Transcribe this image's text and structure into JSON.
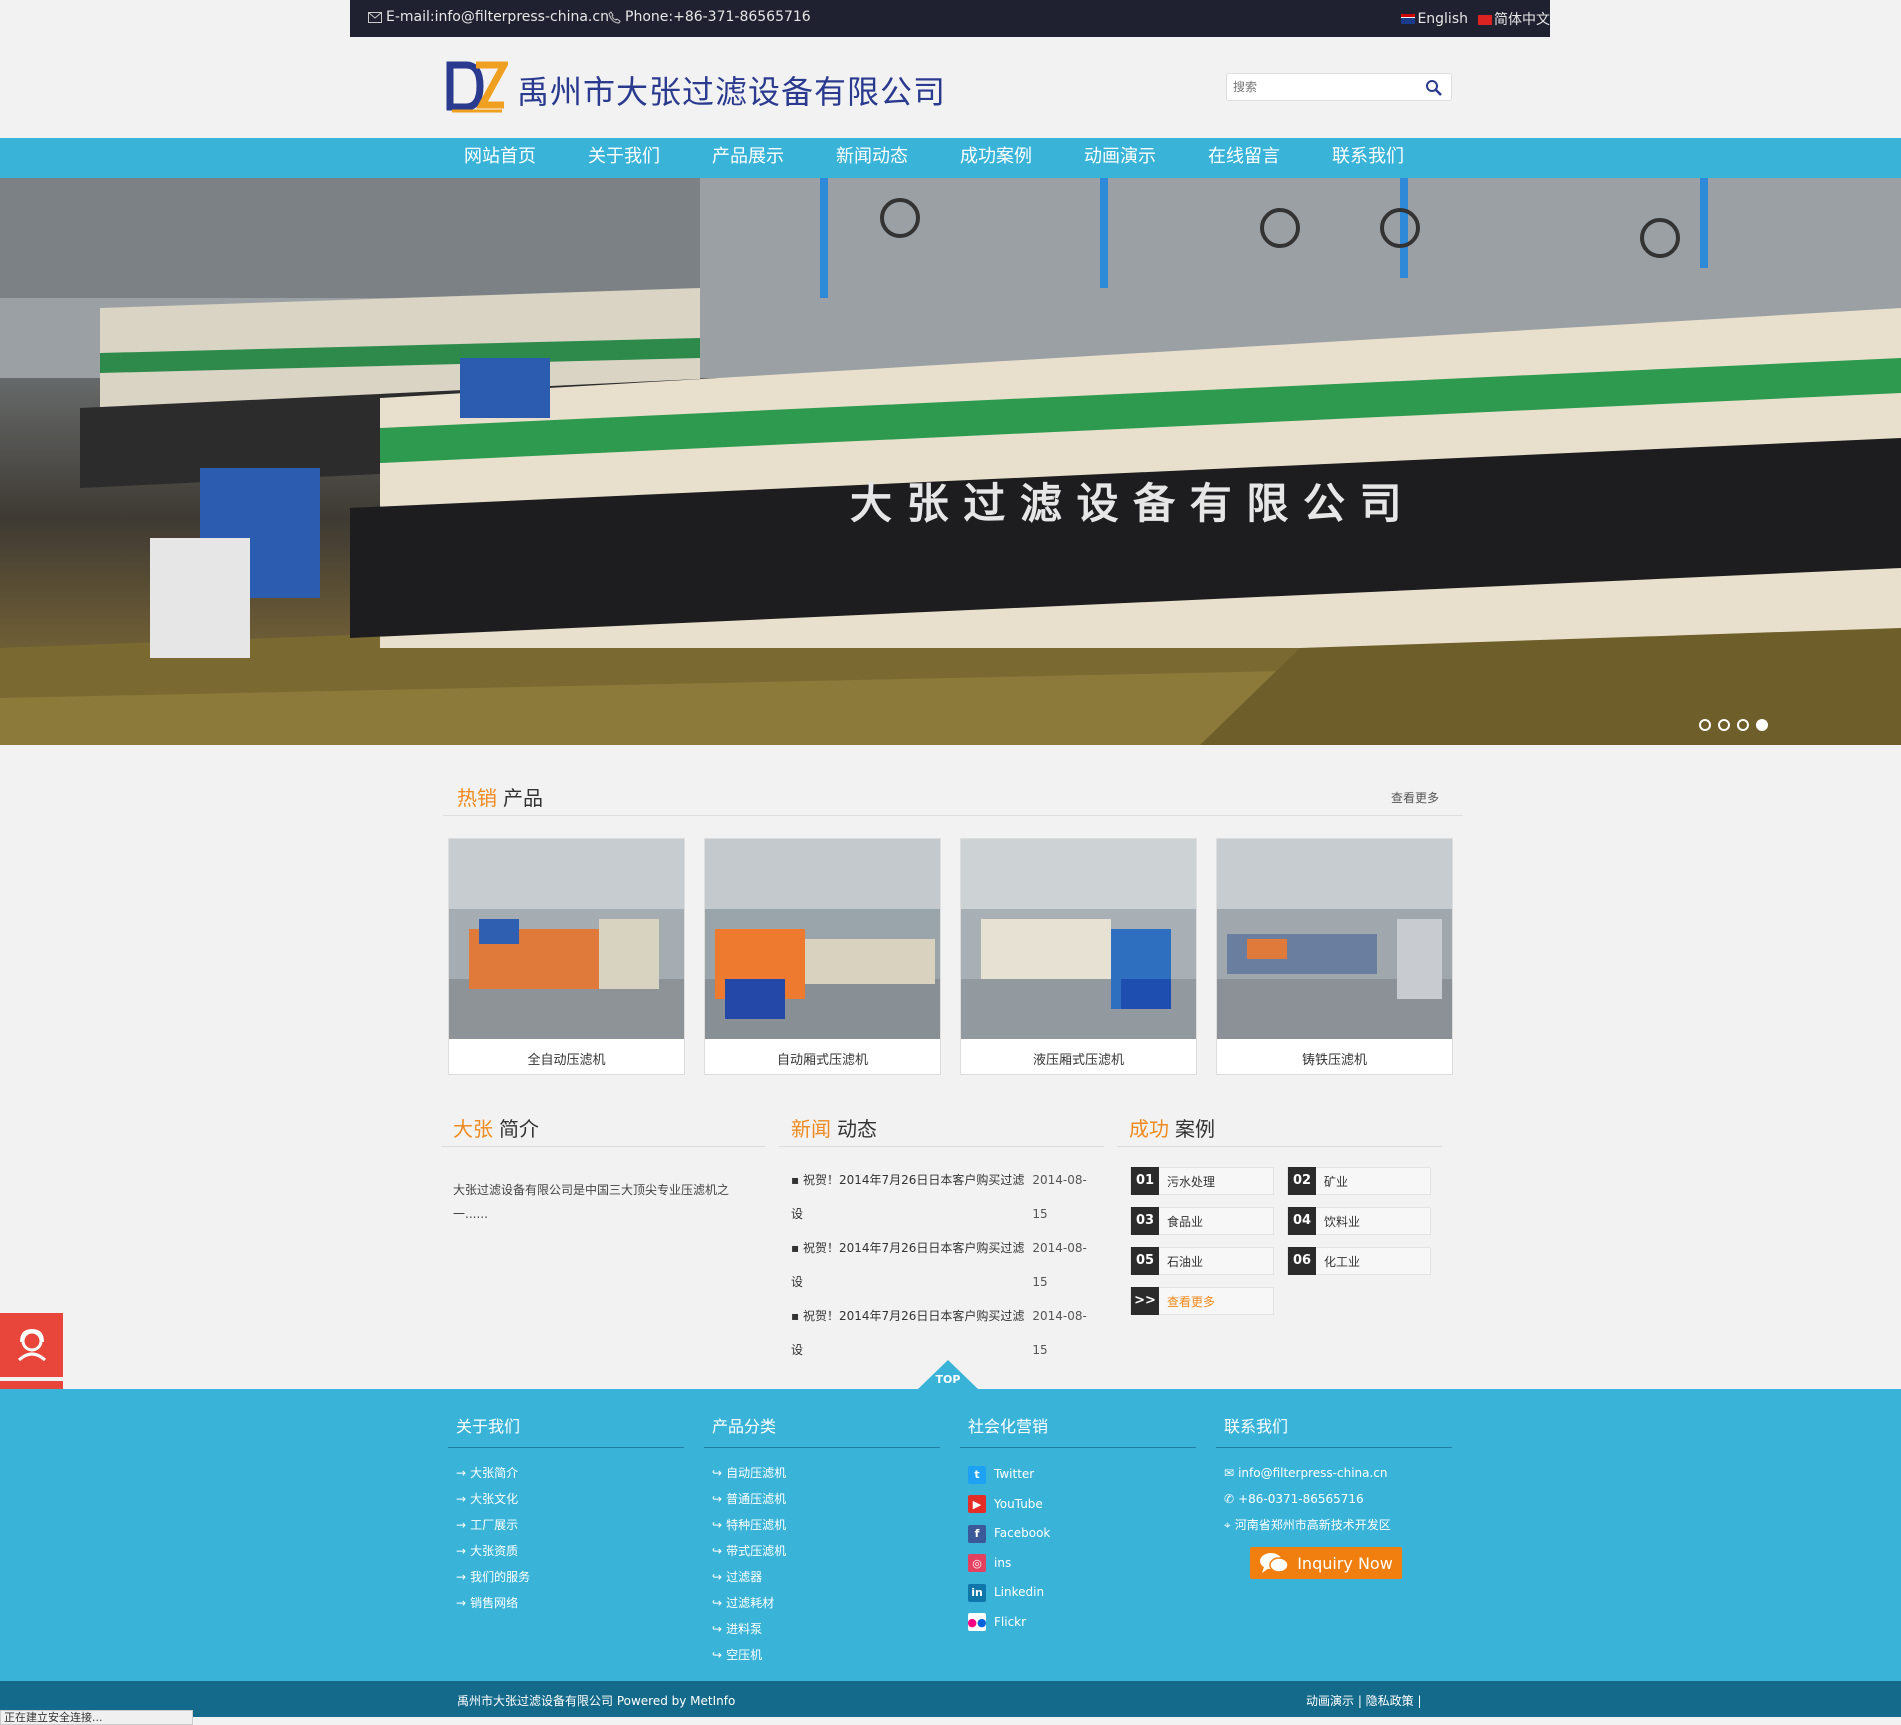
{
  "topbar": {
    "email": "E-mail:info@filterpress-china.cn",
    "phone": "Phone:+86-371-86565716",
    "lang_en": "English",
    "lang_cn": "简体中文"
  },
  "header": {
    "company_name": "禹州市大张过滤设备有限公司",
    "search_placeholder": "搜索"
  },
  "nav": [
    "网站首页",
    "关于我们",
    "产品展示",
    "新闻动态",
    "成功案例",
    "动画演示",
    "在线留言",
    "联系我们"
  ],
  "banner": {
    "slide_count": 4,
    "active_slide": 4,
    "machine_text": "大 张 过 滤 设 备 有 限 公 司"
  },
  "hot_products": {
    "title_hl": "热销",
    "title_rest": "产品",
    "more": "查看更多",
    "items": [
      "全自动压滤机",
      "自动厢式压滤机",
      "液压厢式压滤机",
      "铸铁压滤机"
    ]
  },
  "intro": {
    "title_hl": "大张",
    "title_rest": "简介",
    "text": "大张过滤设备有限公司是中国三大顶尖专业压滤机之一......"
  },
  "news": {
    "title_hl": "新闻",
    "title_rest": "动态",
    "items": [
      {
        "title": "▪ 祝贺！2014年7月26日日本客户购买过滤设",
        "date": "2014-08-15"
      },
      {
        "title": "▪ 祝贺！2014年7月26日日本客户购买过滤设",
        "date": "2014-08-15"
      },
      {
        "title": "▪ 祝贺！2014年7月26日日本客户购买过滤设",
        "date": "2014-08-15"
      }
    ]
  },
  "cases": {
    "title_hl": "成功",
    "title_rest": "案例",
    "items": [
      {
        "num": "01",
        "label": "污水处理"
      },
      {
        "num": "02",
        "label": "矿业"
      },
      {
        "num": "03",
        "label": "食品业"
      },
      {
        "num": "04",
        "label": "饮料业"
      },
      {
        "num": "05",
        "label": "石油业"
      },
      {
        "num": "06",
        "label": "化工业"
      }
    ],
    "more_num": ">>",
    "more_label": "查看更多"
  },
  "top_label": "TOP",
  "footer": {
    "about": {
      "title": "关于我们",
      "items": [
        "大张简介",
        "大张文化",
        "工厂展示",
        "大张资质",
        "我们的服务",
        "销售网络"
      ]
    },
    "products": {
      "title": "产品分类",
      "items": [
        "自动压滤机",
        "普通压滤机",
        "特种压滤机",
        "带式压滤机",
        "过滤器",
        "过滤耗材",
        "进料泵",
        "空压机"
      ]
    },
    "social": {
      "title": "社会化营销",
      "items": [
        "Twitter",
        "YouTube",
        "Facebook",
        "ins",
        "Linkedin",
        "Flickr"
      ]
    },
    "contact": {
      "title": "联系我们",
      "email": "info@filterpress-china.cn",
      "phone": "+86-0371-86565716",
      "address": "河南省郑州市高新技术开发区",
      "inquiry": "Inquiry Now"
    }
  },
  "bottom": {
    "copyright": "禹州市大张过滤设备有限公司 Powered by MetInfo",
    "links": "动画演示  |  隐私政策  |"
  },
  "status_text": "正在建立安全连接...",
  "colors": {
    "nav_bg": "#39b4d8",
    "accent_orange": "#f08a1e",
    "footer_dark": "#146a8a",
    "float_red": "#e8463a",
    "topbar_bg": "#1f2030"
  }
}
